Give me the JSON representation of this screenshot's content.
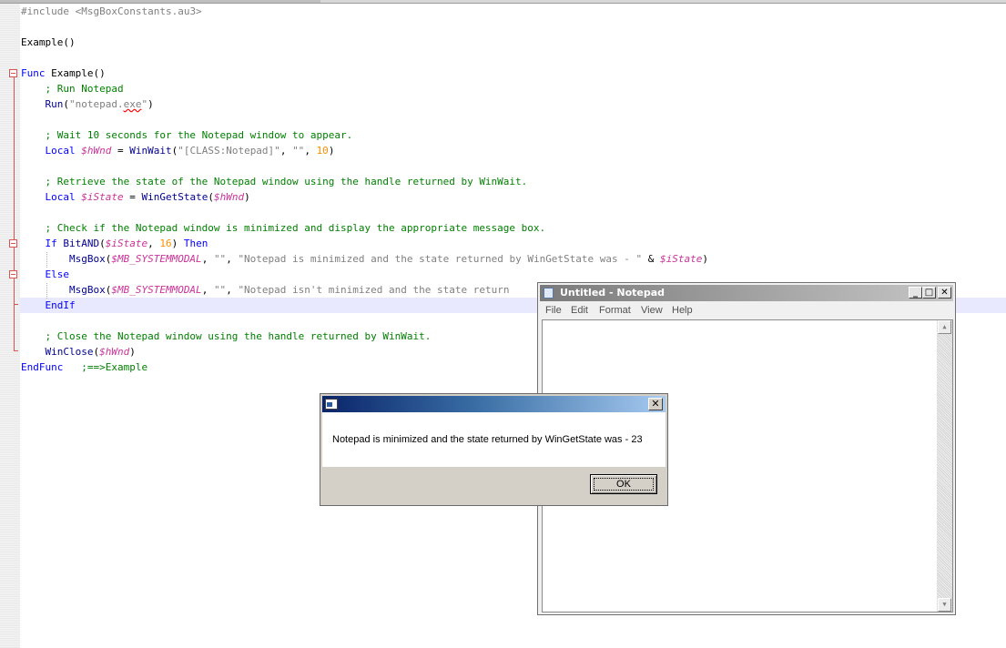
{
  "editor": {
    "lines": [
      {
        "segments": [
          {
            "c": "c-pre",
            "t": "#include "
          },
          {
            "c": "c-str",
            "t": "<MsgBoxConstants.au3>"
          }
        ]
      },
      {
        "segments": []
      },
      {
        "segments": [
          {
            "c": "c-plain",
            "t": "Example()"
          }
        ]
      },
      {
        "segments": []
      },
      {
        "segments": [
          {
            "c": "c-kw",
            "t": "Func"
          },
          {
            "c": "c-plain",
            "t": " Example()"
          }
        ]
      },
      {
        "segments": [
          {
            "c": "c-com",
            "t": "    ; Run Notepad"
          }
        ]
      },
      {
        "segments": [
          {
            "c": "c-fn",
            "t": "    Run"
          },
          {
            "c": "c-plain",
            "t": "("
          },
          {
            "c": "c-str",
            "t": "\"notepad."
          },
          {
            "c": "c-str squiggle",
            "t": "exe"
          },
          {
            "c": "c-str",
            "t": "\""
          },
          {
            "c": "c-plain",
            "t": ")"
          }
        ]
      },
      {
        "segments": []
      },
      {
        "segments": [
          {
            "c": "c-com",
            "t": "    ; Wait 10 seconds for the Notepad window to appear."
          }
        ]
      },
      {
        "segments": [
          {
            "c": "c-kw",
            "t": "    Local "
          },
          {
            "c": "c-var",
            "t": "$hWnd"
          },
          {
            "c": "c-plain",
            "t": " = "
          },
          {
            "c": "c-fn",
            "t": "WinWait"
          },
          {
            "c": "c-plain",
            "t": "("
          },
          {
            "c": "c-str",
            "t": "\"[CLASS:Notepad]\""
          },
          {
            "c": "c-plain",
            "t": ", "
          },
          {
            "c": "c-str",
            "t": "\"\""
          },
          {
            "c": "c-plain",
            "t": ", "
          },
          {
            "c": "c-num",
            "t": "10"
          },
          {
            "c": "c-plain",
            "t": ")"
          }
        ]
      },
      {
        "segments": []
      },
      {
        "segments": [
          {
            "c": "c-com",
            "t": "    ; Retrieve the state of the Notepad window using the handle returned by WinWait."
          }
        ]
      },
      {
        "segments": [
          {
            "c": "c-kw",
            "t": "    Local "
          },
          {
            "c": "c-var",
            "t": "$iState"
          },
          {
            "c": "c-plain",
            "t": " = "
          },
          {
            "c": "c-fn",
            "t": "WinGetState"
          },
          {
            "c": "c-plain",
            "t": "("
          },
          {
            "c": "c-var",
            "t": "$hWnd"
          },
          {
            "c": "c-plain",
            "t": ")"
          }
        ]
      },
      {
        "segments": []
      },
      {
        "segments": [
          {
            "c": "c-com",
            "t": "    ; Check if the Notepad window is minimized and display the appropriate message box."
          }
        ]
      },
      {
        "segments": [
          {
            "c": "c-kw",
            "t": "    If "
          },
          {
            "c": "c-fn",
            "t": "BitAND"
          },
          {
            "c": "c-plain",
            "t": "("
          },
          {
            "c": "c-var",
            "t": "$iState"
          },
          {
            "c": "c-plain",
            "t": ", "
          },
          {
            "c": "c-num",
            "t": "16"
          },
          {
            "c": "c-plain",
            "t": ") "
          },
          {
            "c": "c-kw",
            "t": "Then"
          }
        ]
      },
      {
        "segments": [
          {
            "c": "c-fn",
            "t": "        MsgBox"
          },
          {
            "c": "c-plain",
            "t": "("
          },
          {
            "c": "c-mac",
            "t": "$MB_SYSTEMMODAL"
          },
          {
            "c": "c-plain",
            "t": ", "
          },
          {
            "c": "c-str",
            "t": "\"\""
          },
          {
            "c": "c-plain",
            "t": ", "
          },
          {
            "c": "c-str",
            "t": "\"Notepad is minimized and the state returned by WinGetState was - \""
          },
          {
            "c": "c-plain",
            "t": " & "
          },
          {
            "c": "c-var",
            "t": "$iState"
          },
          {
            "c": "c-plain",
            "t": ")"
          }
        ]
      },
      {
        "segments": [
          {
            "c": "c-kw",
            "t": "    Else"
          }
        ]
      },
      {
        "segments": [
          {
            "c": "c-fn",
            "t": "        MsgBox"
          },
          {
            "c": "c-plain",
            "t": "("
          },
          {
            "c": "c-mac",
            "t": "$MB_SYSTEMMODAL"
          },
          {
            "c": "c-plain",
            "t": ", "
          },
          {
            "c": "c-str",
            "t": "\"\""
          },
          {
            "c": "c-plain",
            "t": ", "
          },
          {
            "c": "c-str",
            "t": "\"Notepad isn't minimized and the state return"
          }
        ]
      },
      {
        "segments": [
          {
            "c": "c-kw",
            "t": "    EndIf"
          }
        ]
      },
      {
        "segments": []
      },
      {
        "segments": [
          {
            "c": "c-com",
            "t": "    ; Close the Notepad window using the handle returned by WinWait."
          }
        ]
      },
      {
        "segments": [
          {
            "c": "c-fn",
            "t": "    WinClose"
          },
          {
            "c": "c-plain",
            "t": "("
          },
          {
            "c": "c-var",
            "t": "$hWnd"
          },
          {
            "c": "c-plain",
            "t": ")"
          }
        ]
      },
      {
        "segments": [
          {
            "c": "c-kw",
            "t": "EndFunc"
          },
          {
            "c": "c-plain",
            "t": "   "
          },
          {
            "c": "c-com",
            "t": ";==>Example"
          }
        ]
      }
    ]
  },
  "notepad": {
    "title": "Untitled - Notepad",
    "menu": [
      "File",
      "Edit",
      "Format",
      "View",
      "Help"
    ],
    "minimize_glyph": "_",
    "maximize_glyph": "□",
    "close_glyph": "✕",
    "scroll_up_glyph": "▲",
    "scroll_down_glyph": "▼"
  },
  "msgbox": {
    "title": "",
    "message": "Notepad is minimized and the state returned by WinGetState was - 23",
    "ok_label": "OK",
    "close_glyph": "✕"
  },
  "colors": {
    "keyword": "#0000ff",
    "function": "#000090",
    "comment": "#008000",
    "variable": "#cc3399",
    "string": "#808080",
    "number": "#ff8c00",
    "fold_marker": "#d9534f",
    "msgbox_title_start": "#0a246a",
    "msgbox_title_end": "#a6caf0"
  }
}
